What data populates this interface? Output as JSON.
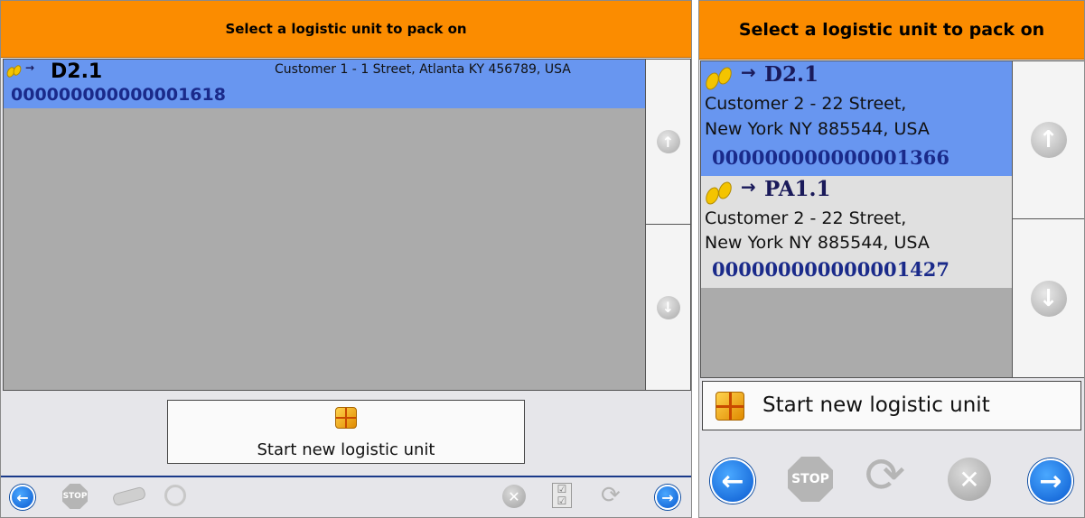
{
  "left_panel": {
    "header": "Select a logistic unit to pack on",
    "items": [
      {
        "title": "D2.1",
        "address": "Customer 1 - 1 Street, Atlanta KY  456789, USA",
        "code": "000000000000001618",
        "selected": true
      }
    ],
    "start_button": "Start new logistic unit",
    "toolbar": {
      "back_icon": "arrow-left-icon",
      "stop_label": "STOP",
      "stop_icon": "stop-icon",
      "eraser_icon": "eraser-icon",
      "stopwatch_icon": "stopwatch-icon",
      "cancel_icon": "cancel-icon",
      "checklist_icon": "checklist-icon",
      "refresh_icon": "refresh-icon",
      "forward_icon": "arrow-right-icon"
    }
  },
  "right_panel": {
    "header": "Select a logistic unit to pack on",
    "items": [
      {
        "title": "D2.1",
        "address_line1": "Customer 2 - 22 Street,",
        "address_line2": "New York NY  885544, USA",
        "code": "000000000000001366",
        "selected": true
      },
      {
        "title": "PA1.1",
        "address_line1": "Customer 2 - 22 Street,",
        "address_line2": "New York NY  885544, USA",
        "code": "000000000000001427",
        "selected": false
      }
    ],
    "start_button": "Start new logistic unit",
    "toolbar": {
      "back_icon": "arrow-left-icon",
      "stop_label": "STOP",
      "stop_icon": "stop-icon",
      "refresh_icon": "refresh-icon",
      "cancel_icon": "cancel-icon",
      "forward_icon": "arrow-right-icon"
    }
  },
  "colors": {
    "header": "#fb8c00",
    "selected_row": "#6896f0",
    "list_bg": "#ababab",
    "code_text": "#1a2a8a",
    "nav_blue": "#0a5ad0"
  }
}
